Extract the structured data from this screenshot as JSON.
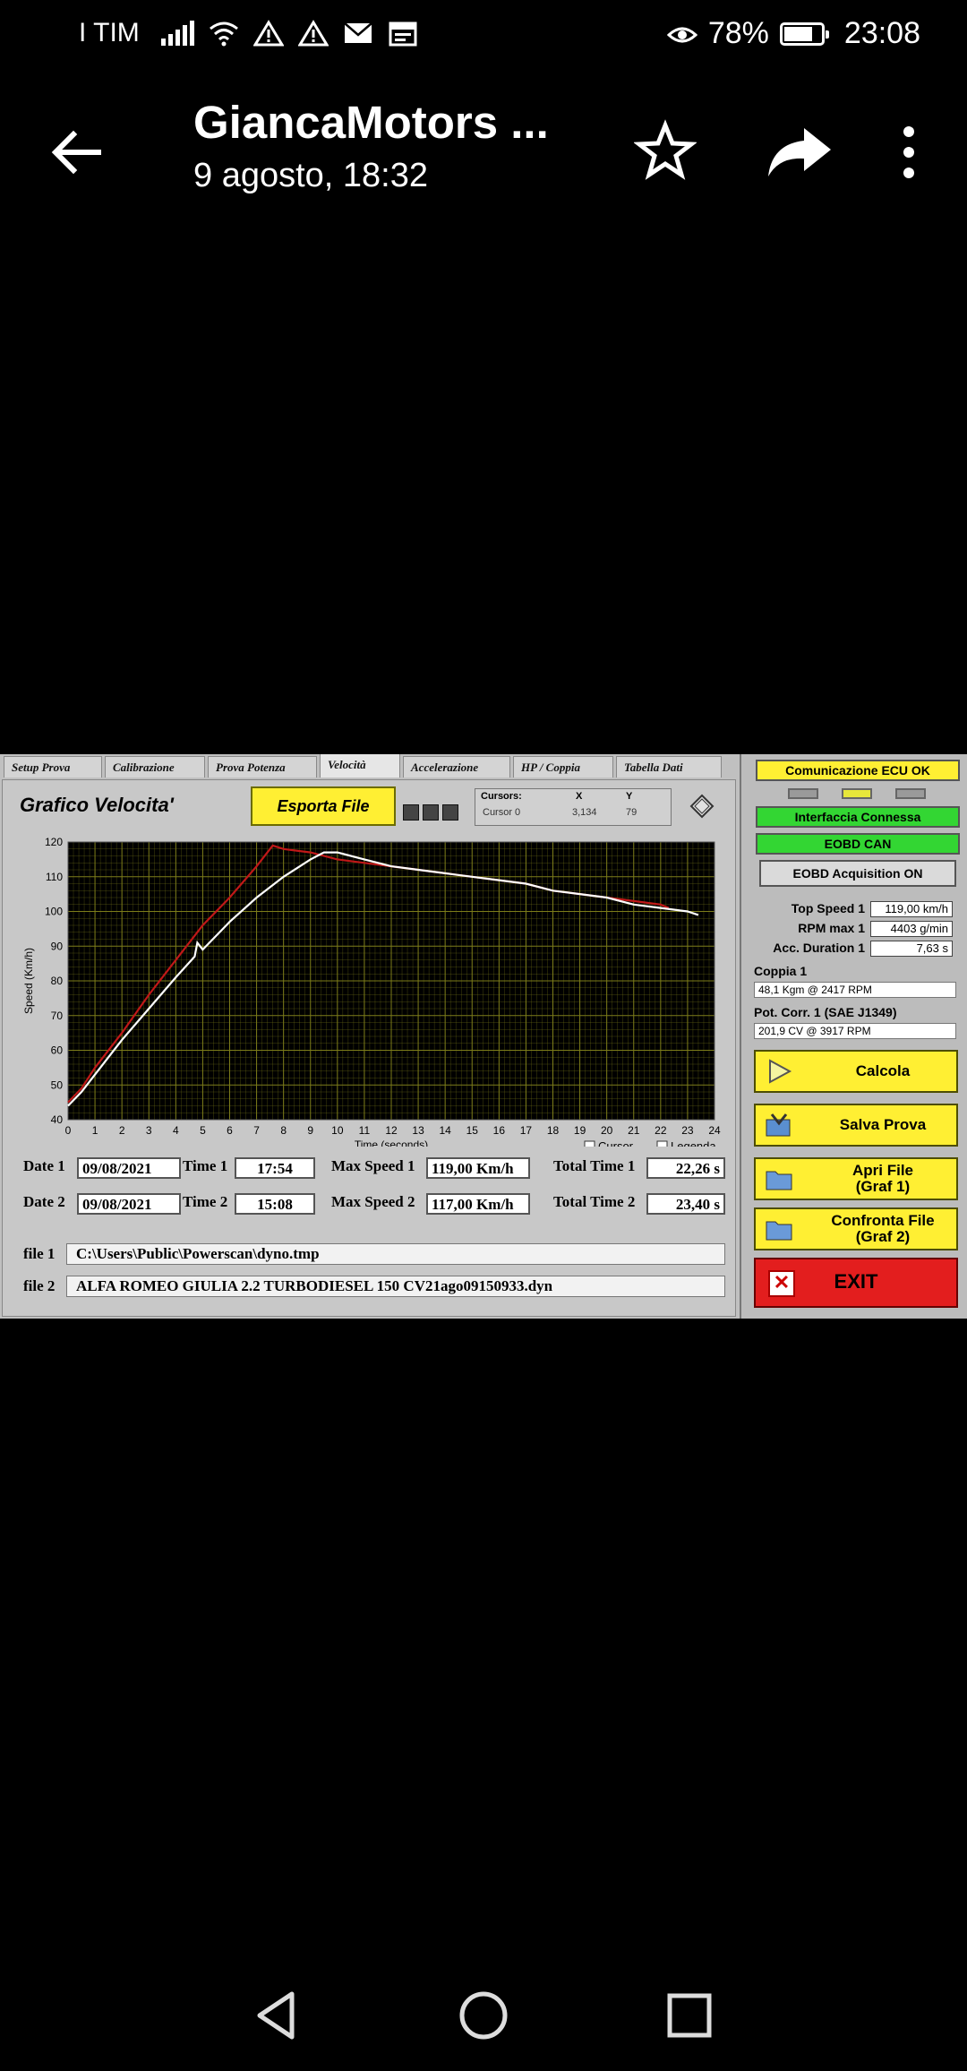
{
  "status_bar": {
    "carrier": "I TIM",
    "battery": "78%",
    "battery_level": 0.78,
    "time": "23:08"
  },
  "app_bar": {
    "title": "GiancaMotors ...",
    "subtitle": "9 agosto, 18:32"
  },
  "screenshot": {
    "tabs": [
      "Setup Prova",
      "Calibrazione",
      "Prova Potenza",
      "Velocità",
      "Accelerazione",
      "HP / Coppia",
      "Tabella Dati"
    ],
    "active_tab": "Velocità",
    "graph_title": "Grafico Velocita'",
    "export_label": "Esporta File",
    "cursors": {
      "title": "Cursors:",
      "x_label": "X",
      "y_label": "Y",
      "name": "Cursor 0",
      "x_value": "3,134",
      "y_value": "79"
    },
    "checkbox_cursor": "Cursor",
    "checkbox_legend": "Legenda",
    "date1_label": "Date 1",
    "date1": "09/08/2021",
    "time1_label": "Time 1",
    "time1": "17:54",
    "maxspeed1_label": "Max Speed 1",
    "maxspeed1": "119,00 Km/h",
    "totaltime1_label": "Total Time 1",
    "totaltime1": "22,26 s",
    "date2_label": "Date 2",
    "date2": "09/08/2021",
    "time2_label": "Time 2",
    "time2": "15:08",
    "maxspeed2_label": "Max Speed 2",
    "maxspeed2": "117,00 Km/h",
    "totaltime2_label": "Total Time 2",
    "totaltime2": "23,40 s",
    "file1_label": "file 1",
    "file1": "C:\\Users\\Public\\Powerscan\\dyno.tmp",
    "file2_label": "file 2",
    "file2": "ALFA ROMEO GIULIA 2.2 TURBODIESEL 150 CV21ago09150933.dyn",
    "side": {
      "comm": "Comunicazione ECU OK",
      "iface": "Interfaccia Connessa",
      "eobd": "EOBD CAN",
      "acq": "EOBD Acquisition ON",
      "topspeed_label": "Top Speed 1",
      "topspeed": "119,00 km/h",
      "rpm_label": "RPM max 1",
      "rpm": "4403 g/min",
      "accdur_label": "Acc. Duration 1",
      "accdur": "7,63 s",
      "coppia_label": "Coppia 1",
      "coppia": "48,1 Kgm  @ 2417  RPM",
      "pot_label": "Pot. Corr. 1 (SAE J1349)",
      "pot": "201,9 CV  @ 3917  RPM",
      "calcola": "Calcola",
      "salva": "Salva Prova",
      "apri": "Apri File\n(Graf 1)",
      "confronta": "Confronta File\n(Graf 2)",
      "exit": "EXIT"
    }
  },
  "chart_data": {
    "type": "line",
    "xlabel": "Time (seconds)",
    "ylabel": "Speed (Km/h)",
    "xlim": [
      0,
      24
    ],
    "ylim": [
      40,
      120
    ],
    "xticks": [
      0,
      1,
      2,
      3,
      4,
      5,
      6,
      7,
      8,
      9,
      10,
      11,
      12,
      13,
      14,
      15,
      16,
      17,
      18,
      19,
      20,
      21,
      22,
      23,
      24
    ],
    "yticks": [
      40,
      50,
      60,
      70,
      80,
      90,
      100,
      110,
      120
    ],
    "grid": true,
    "colors": {
      "background": "#000000",
      "grid": "#7d7d1a",
      "series1": "#c01818",
      "series2": "#ffffff"
    },
    "series": [
      {
        "color": "#c01818",
        "x": [
          0,
          0.5,
          1,
          2,
          3,
          4,
          5,
          6,
          7,
          7.6,
          8,
          9,
          10,
          11,
          12,
          13,
          14,
          15,
          16,
          17,
          18,
          19,
          20,
          21,
          22,
          22.3
        ],
        "y": [
          45,
          49,
          55,
          65,
          76,
          86,
          96,
          104,
          113,
          119,
          118,
          117,
          115,
          114,
          113,
          112,
          111,
          110,
          109,
          108,
          106,
          105,
          104,
          103,
          102,
          101
        ]
      },
      {
        "color": "#ffffff",
        "x": [
          0,
          0.5,
          1,
          2,
          3,
          4,
          4.7,
          4.8,
          5,
          6,
          7,
          8,
          9,
          9.5,
          10,
          11,
          12,
          13,
          14,
          15,
          16,
          17,
          18,
          19,
          20,
          21,
          22,
          23,
          23.4
        ],
        "y": [
          44,
          48,
          53,
          63,
          72,
          81,
          87,
          91,
          89,
          97,
          104,
          110,
          115,
          117,
          117,
          115,
          113,
          112,
          111,
          110,
          109,
          108,
          106,
          105,
          104,
          102,
          101,
          100,
          99
        ]
      }
    ]
  }
}
